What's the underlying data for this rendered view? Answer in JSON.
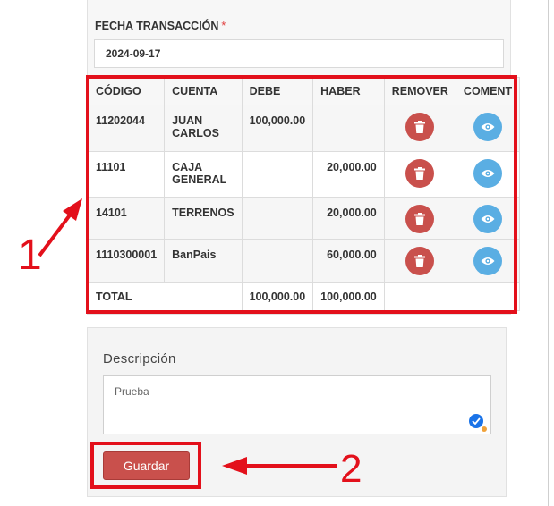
{
  "form": {
    "fecha_label": "FECHA TRANSACCIÓN",
    "required_mark": "*",
    "fecha_value": "2024-09-17"
  },
  "table": {
    "headers": {
      "codigo": "CÓDIGO",
      "cuenta": "CUENTA",
      "debe": "DEBE",
      "haber": "HABER",
      "remover": "REMOVER",
      "coment": "COMENT"
    },
    "rows": [
      {
        "codigo": "11202044",
        "cuenta": "JUAN CARLOS",
        "debe": "100,000.00",
        "haber": ""
      },
      {
        "codigo": "11101",
        "cuenta": "CAJA GENERAL",
        "debe": "",
        "haber": "20,000.00"
      },
      {
        "codigo": "14101",
        "cuenta": "TERRENOS",
        "debe": "",
        "haber": "20,000.00"
      },
      {
        "codigo": "1110300001",
        "cuenta": "BanPais",
        "debe": "",
        "haber": "60,000.00"
      }
    ],
    "total": {
      "label": "TOTAL",
      "debe": "100,000.00",
      "haber": "100,000.00"
    },
    "remove_icon": "trash-icon",
    "comment_icon": "eye-icon"
  },
  "description": {
    "label": "Descripción",
    "value": "Prueba"
  },
  "actions": {
    "save_label": "Guardar"
  },
  "annotations": {
    "mark_1": "1",
    "mark_2": "2"
  },
  "colors": {
    "danger": "#c9504c",
    "info": "#5aaee3",
    "highlight": "#e3101b"
  }
}
